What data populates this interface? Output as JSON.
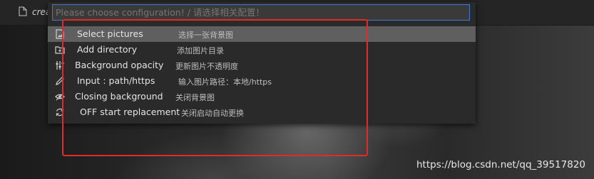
{
  "tab": {
    "name": "crea"
  },
  "quick_pick": {
    "placeholder": "Please choose configuration! / 请选择相关配置！",
    "items": [
      {
        "label": "Select pictures",
        "description": "选择一张背景图",
        "icon": "image-file-icon"
      },
      {
        "label": "Add directory",
        "description": "添加图片目录",
        "icon": "folder-add-icon"
      },
      {
        "label": "Background opacity",
        "description": "更新图片不透明度",
        "icon": "sliders-icon"
      },
      {
        "label": "Input : path/https",
        "description": "输入图片路径：本地/https",
        "icon": "pencil-icon"
      },
      {
        "label": "Closing background",
        "description": "关闭背景图",
        "icon": "eye-off-icon"
      },
      {
        "label": "OFF start replacement",
        "description": "关闭启动自动更换",
        "icon": "refresh-icon"
      }
    ]
  },
  "watermark": "https://blog.csdn.net/qq_39517820",
  "colors": {
    "focus_border": "#3d7bd6",
    "selected_row": "#5f5f5f",
    "annotation": "#e02b2b"
  }
}
